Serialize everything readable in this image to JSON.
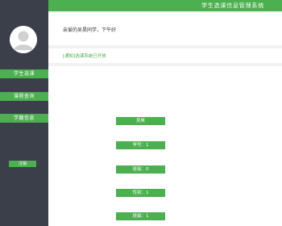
{
  "header": {
    "title": "学生选课信息管理系统"
  },
  "sidebar": {
    "avatar": "user-avatar-icon",
    "items": [
      {
        "label": "学生选课"
      },
      {
        "label": "课程查询"
      },
      {
        "label": "学籍信息"
      }
    ],
    "logout_label": "注销"
  },
  "main": {
    "greeting": "亲爱的吴昊同学，下午好",
    "notice": "[通知]选课系统已开放",
    "info": [
      {
        "text": "吴昊"
      },
      {
        "text": "学号：1"
      },
      {
        "text": "班级：0"
      },
      {
        "text": "性别：1"
      },
      {
        "text": "班级：1"
      }
    ]
  },
  "colors": {
    "accent": "#4caf50",
    "sidebar": "#3a3f4a",
    "background": "#f2f2f2"
  }
}
